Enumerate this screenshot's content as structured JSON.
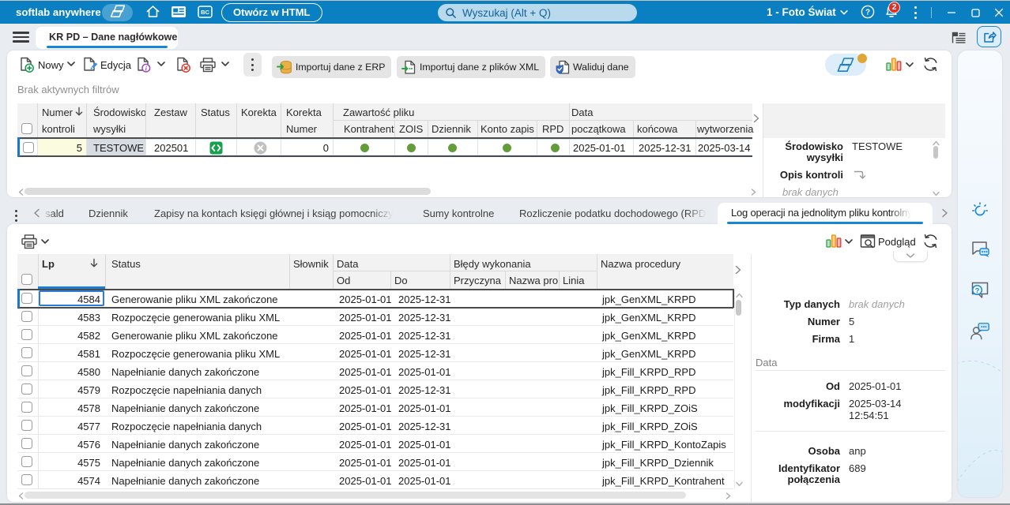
{
  "titlebar": {
    "app_name": "softlab anywhere",
    "open_in_html": "Otwórz w HTML",
    "search_placeholder": "Wyszukaj (Alt + Q)",
    "company": "1 - Foto Świat",
    "notifications_badge": "2"
  },
  "nav": {
    "active_tab": "KR PD – Dane nagłówkowe"
  },
  "toolbar": {
    "new": "Nowy",
    "edit": "Edycja",
    "import_erp": "Importuj dane z ERP",
    "import_xml": "Importuj dane z plików XML",
    "validate": "Waliduj dane"
  },
  "filter_note": "Brak aktywnych filtrów",
  "grid1": {
    "headers": {
      "numer_l1": "Numer",
      "numer_l2": "kontroli",
      "srodowisko_l1": "Środowisko",
      "srodowisko_l2": "wysyłki",
      "zestaw": "Zestaw",
      "status": "Status",
      "korekta": "Korekta",
      "korekta_numer_l1": "Korekta",
      "korekta_numer_l2": "Numer",
      "band_zawartosc": "Zawartość pliku",
      "kontrahent": "Kontrahent",
      "zois": "ZOIS",
      "dziennik": "Dziennik",
      "konto_zapis": "Konto zapis",
      "rpd": "RPD",
      "band_data": "Data",
      "poczatkowa": "początkowa",
      "koncowa": "końcowa",
      "wytworzenia": "wytworzenia"
    },
    "row": {
      "numer": "5",
      "srodowisko": "TESTOWE",
      "zestaw": "202501",
      "korekta_numer": "0",
      "data_poczatkowa": "2025-01-01",
      "data_koncowa": "2025-12-31",
      "data_wytworzenia": "2025-03-14"
    }
  },
  "panel1": {
    "field1_label_l1": "Środowisko",
    "field1_label_l2": "wysyłki",
    "field1_value": "TESTOWE",
    "field2_label": "Opis kontroli",
    "empty_note": "brak danych"
  },
  "subtabs": {
    "items": [
      {
        "label": "sald"
      },
      {
        "label": "Dziennik"
      },
      {
        "label": "Zapisy na kontach księgi głównej i ksiąg pomocniczych"
      },
      {
        "label": "Sumy kontrolne"
      },
      {
        "label": "Rozliczenie podatku dochodowego (RPD)"
      },
      {
        "label": "Log operacji na jednolitym pliku kontrolnym"
      }
    ]
  },
  "toolbar2": {
    "preview": "Podgląd"
  },
  "grid2": {
    "headers": {
      "lp": "Lp",
      "status": "Status",
      "slownik": "Słownik",
      "band_data": "Data",
      "od": "Od",
      "do": "Do",
      "band_bledy": "Błędy wykonania",
      "przyczyna": "Przyczyna",
      "nazwa_proc": "Nazwa proc",
      "linia": "Linia",
      "nazwa_procedury": "Nazwa procedury"
    },
    "rows": [
      {
        "lp": "4584",
        "status": "Generowanie pliku XML zakończone",
        "od": "2025-01-01",
        "do": "2025-12-31",
        "procedura": "jpk_GenXML_KRPD"
      },
      {
        "lp": "4583",
        "status": "Rozpoczęcie generowania pliku XML",
        "od": "2025-01-01",
        "do": "2025-12-31",
        "procedura": "jpk_GenXML_KRPD"
      },
      {
        "lp": "4582",
        "status": "Generowanie pliku XML zakończone",
        "od": "2025-01-01",
        "do": "2025-12-31",
        "procedura": "jpk_GenXML_KRPD"
      },
      {
        "lp": "4581",
        "status": "Rozpoczęcie generowania pliku XML",
        "od": "2025-01-01",
        "do": "2025-12-31",
        "procedura": "jpk_GenXML_KRPD"
      },
      {
        "lp": "4580",
        "status": "Napełnianie danych zakończone",
        "od": "2025-01-01",
        "do": "2025-01-01",
        "procedura": "jpk_Fill_KRPD_RPD"
      },
      {
        "lp": "4579",
        "status": "Rozpoczęcie napełniania danych",
        "od": "2025-01-01",
        "do": "2025-12-31",
        "procedura": "jpk_Fill_KRPD_RPD"
      },
      {
        "lp": "4578",
        "status": "Napełnianie danych zakończone",
        "od": "2025-01-01",
        "do": "2025-01-01",
        "procedura": "jpk_Fill_KRPD_ZOiS"
      },
      {
        "lp": "4577",
        "status": "Rozpoczęcie napełniania danych",
        "od": "2025-01-01",
        "do": "2025-12-31",
        "procedura": "jpk_Fill_KRPD_ZOiS"
      },
      {
        "lp": "4576",
        "status": "Napełnianie danych zakończone",
        "od": "2025-01-01",
        "do": "2025-01-01",
        "procedura": "jpk_Fill_KRPD_KontoZapis"
      },
      {
        "lp": "4575",
        "status": "Napełnianie danych zakończone",
        "od": "2025-01-01",
        "do": "2025-01-01",
        "procedura": "jpk_Fill_KRPD_Dziennik"
      },
      {
        "lp": "4574",
        "status": "Napełnianie danych zakończone",
        "od": "2025-01-01",
        "do": "2025-01-01",
        "procedura": "jpk_Fill_KRPD_Kontrahent"
      }
    ]
  },
  "panel2": {
    "typ_danych_label": "Typ danych",
    "typ_danych_value": "brak danych",
    "numer_label": "Numer",
    "numer_value": "5",
    "firma_label": "Firma",
    "firma_value": "1",
    "section_data": "Data",
    "od_label": "Od",
    "od_value": "2025-01-01",
    "modyfikacji_label": "modyfikacji",
    "modyfikacji_value_l1": "2025-03-14",
    "modyfikacji_value_l2": "12:54:51",
    "osoba_label": "Osoba",
    "osoba_value": "anp",
    "identyfikator_label_l1": "Identyfikator",
    "identyfikator_label_l2": "połączenia",
    "identyfikator_value": "689"
  }
}
